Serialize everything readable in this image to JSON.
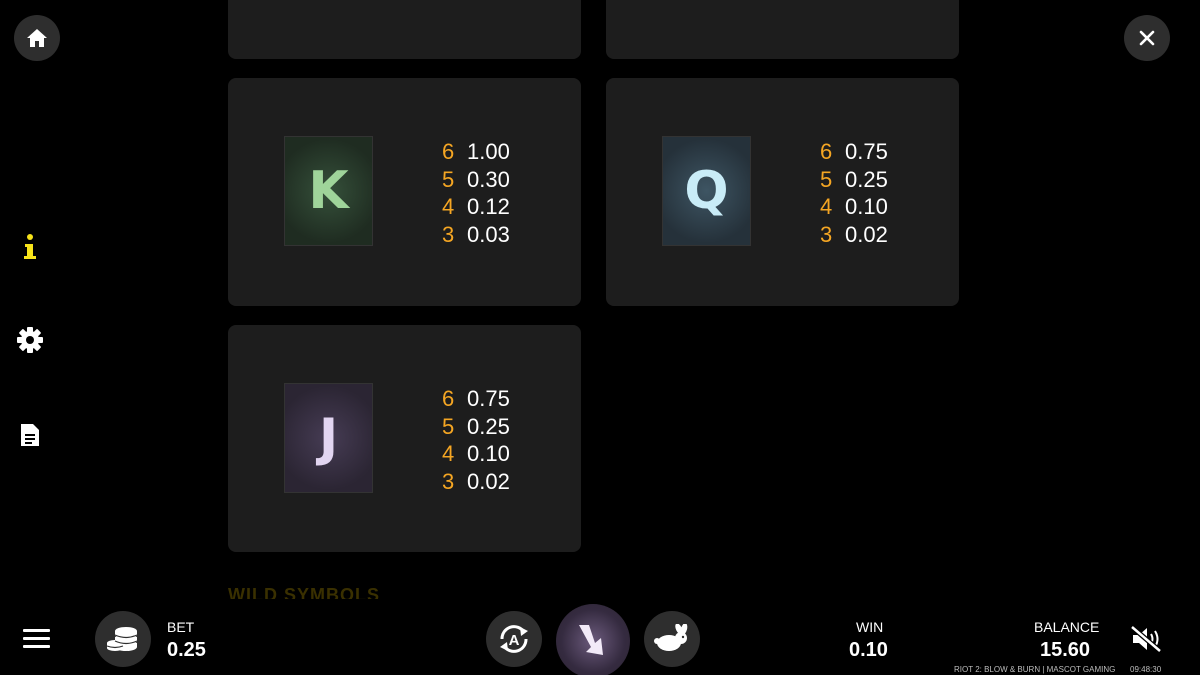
{
  "top_bar": {
    "home_icon": "home-icon",
    "close_icon": "close-icon"
  },
  "sidebar": {
    "items": [
      {
        "icon": "info-icon",
        "active": true
      },
      {
        "icon": "gear-icon"
      },
      {
        "icon": "document-icon"
      }
    ]
  },
  "paytable": {
    "symbols": [
      {
        "letter": "K",
        "color": "#9fd49a",
        "tile_bg": "#1f2c21",
        "pays": [
          {
            "count": "6",
            "value": "1.00"
          },
          {
            "count": "5",
            "value": "0.30"
          },
          {
            "count": "4",
            "value": "0.12"
          },
          {
            "count": "3",
            "value": "0.03"
          }
        ]
      },
      {
        "letter": "Q",
        "color": "#c9ecf7",
        "tile_bg": "#25313a",
        "pays": [
          {
            "count": "6",
            "value": "0.75"
          },
          {
            "count": "5",
            "value": "0.25"
          },
          {
            "count": "4",
            "value": "0.10"
          },
          {
            "count": "3",
            "value": "0.02"
          }
        ]
      },
      {
        "letter": "J",
        "color": "#e2d5f1",
        "tile_bg": "#2b2533",
        "pays": [
          {
            "count": "6",
            "value": "0.75"
          },
          {
            "count": "5",
            "value": "0.25"
          },
          {
            "count": "4",
            "value": "0.10"
          },
          {
            "count": "3",
            "value": "0.02"
          }
        ]
      }
    ],
    "next_section_title": "WILD SYMBOLS"
  },
  "bottom_bar": {
    "bet_label": "BET",
    "bet_value": "0.25",
    "win_label": "WIN",
    "win_value": "0.10",
    "balance_label": "BALANCE",
    "balance_value": "15.60",
    "game_name": "RIOT 2: BLOW & BURN | MASCOT GAMING",
    "time": "09:48:30"
  },
  "colors": {
    "accent": "#f5a623",
    "info_active": "#f7e31a",
    "panel_bg": "#1d1d1d"
  }
}
